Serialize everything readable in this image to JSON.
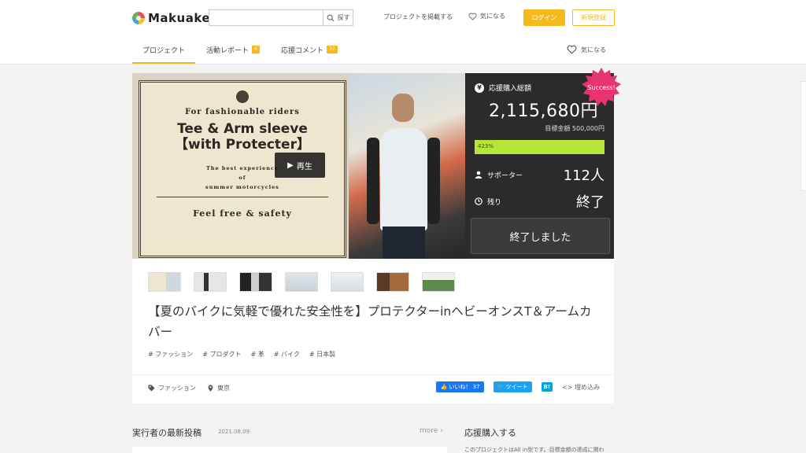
{
  "header": {
    "logo": "Makuake",
    "search_placeholder": "",
    "search_label": "探す",
    "post_project": "プロジェクトを掲載する",
    "favorite": "気になる",
    "login": "ログイン",
    "register": "新規登録"
  },
  "tabs": [
    {
      "label": "プロジェクト",
      "badge": ""
    },
    {
      "label": "活動レポート",
      "badge": "6"
    },
    {
      "label": "応援コメント",
      "badge": "37"
    }
  ],
  "tab_favorite": "気になる",
  "hero": {
    "play_label": "再生",
    "poster_line1": "For fashionable riders",
    "poster_line2": "Tee & Arm sleeve",
    "poster_line3": "【with Protecter】",
    "poster_line4": "The best experience",
    "poster_line5": "of",
    "poster_line6": "summer motorcycles",
    "poster_line7": "Feel free & safety"
  },
  "stats": {
    "total_label": "応援購入総額",
    "amount": "2,115,680円",
    "goal": "目標金額 500,000円",
    "progress_label": "423%",
    "progress_fraction": 1.0,
    "supporters_label": "サポーター",
    "supporters_value": "112人",
    "remaining_label": "残り",
    "remaining_value": "終了",
    "ended_button": "終了しました",
    "success_badge": "Success!"
  },
  "title": "【夏のバイクに気軽で優れた安全性を】プロテクターinヘビーオンスT＆アームカバー",
  "tags": [
    "# ファッション",
    "# プロダクト",
    "# 革",
    "# バイク",
    "# 日本製"
  ],
  "meta": {
    "category": "ファッション",
    "location": "東京"
  },
  "share": {
    "facebook": "いいね！ 37",
    "twitter": "ツイート",
    "hatena": "B!",
    "embed": "埋め込み"
  },
  "posts": {
    "title": "実行者の最新投稿",
    "date": "2021.08.09",
    "more": "more"
  },
  "support": {
    "title": "応援購入する",
    "text": "このプロジェクトはAll in型です。目標金額の達成に関わ"
  },
  "colors": {
    "accent": "#f5b91c",
    "progress": "#b6e63a",
    "success": "#e8336f"
  }
}
